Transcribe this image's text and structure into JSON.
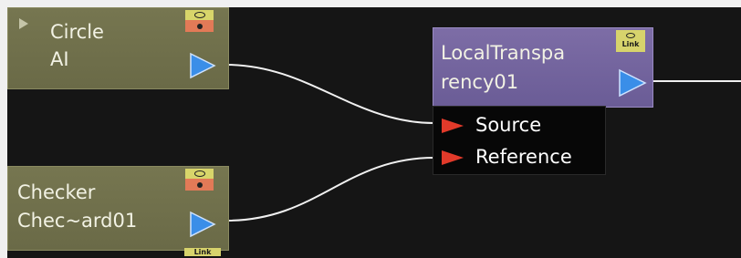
{
  "nodes": {
    "circle": {
      "expand_icon": "expand-triangle-icon",
      "title": "Circle",
      "subtitle": "AI"
    },
    "checker": {
      "title": "Checker",
      "subtitle": "Chec~ard01",
      "link_label": "Link"
    },
    "local_transparency": {
      "title_line1": "LocalTranspa",
      "title_line2": "rency01",
      "link_label": "Link",
      "inputs": [
        {
          "label": "Source"
        },
        {
          "label": "Reference"
        }
      ]
    }
  },
  "colors": {
    "canvas": "#151515",
    "node_olive": "#767650",
    "node_purple": "#7d6da6",
    "output_port": "#3a8ee8",
    "input_port": "#e23a2a",
    "wire": "#f2f2f2"
  }
}
